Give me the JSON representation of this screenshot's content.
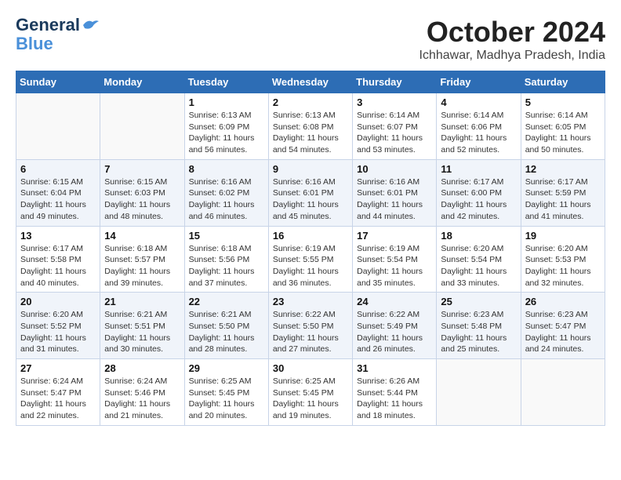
{
  "logo": {
    "line1": "General",
    "line2": "Blue"
  },
  "title": "October 2024",
  "location": "Ichhawar, Madhya Pradesh, India",
  "weekdays": [
    "Sunday",
    "Monday",
    "Tuesday",
    "Wednesday",
    "Thursday",
    "Friday",
    "Saturday"
  ],
  "weeks": [
    [
      {
        "day": null,
        "info": null
      },
      {
        "day": null,
        "info": null
      },
      {
        "day": "1",
        "sunrise": "6:13 AM",
        "sunset": "6:09 PM",
        "daylight": "11 hours and 56 minutes."
      },
      {
        "day": "2",
        "sunrise": "6:13 AM",
        "sunset": "6:08 PM",
        "daylight": "11 hours and 54 minutes."
      },
      {
        "day": "3",
        "sunrise": "6:14 AM",
        "sunset": "6:07 PM",
        "daylight": "11 hours and 53 minutes."
      },
      {
        "day": "4",
        "sunrise": "6:14 AM",
        "sunset": "6:06 PM",
        "daylight": "11 hours and 52 minutes."
      },
      {
        "day": "5",
        "sunrise": "6:14 AM",
        "sunset": "6:05 PM",
        "daylight": "11 hours and 50 minutes."
      }
    ],
    [
      {
        "day": "6",
        "sunrise": "6:15 AM",
        "sunset": "6:04 PM",
        "daylight": "11 hours and 49 minutes."
      },
      {
        "day": "7",
        "sunrise": "6:15 AM",
        "sunset": "6:03 PM",
        "daylight": "11 hours and 48 minutes."
      },
      {
        "day": "8",
        "sunrise": "6:16 AM",
        "sunset": "6:02 PM",
        "daylight": "11 hours and 46 minutes."
      },
      {
        "day": "9",
        "sunrise": "6:16 AM",
        "sunset": "6:01 PM",
        "daylight": "11 hours and 45 minutes."
      },
      {
        "day": "10",
        "sunrise": "6:16 AM",
        "sunset": "6:01 PM",
        "daylight": "11 hours and 44 minutes."
      },
      {
        "day": "11",
        "sunrise": "6:17 AM",
        "sunset": "6:00 PM",
        "daylight": "11 hours and 42 minutes."
      },
      {
        "day": "12",
        "sunrise": "6:17 AM",
        "sunset": "5:59 PM",
        "daylight": "11 hours and 41 minutes."
      }
    ],
    [
      {
        "day": "13",
        "sunrise": "6:17 AM",
        "sunset": "5:58 PM",
        "daylight": "11 hours and 40 minutes."
      },
      {
        "day": "14",
        "sunrise": "6:18 AM",
        "sunset": "5:57 PM",
        "daylight": "11 hours and 39 minutes."
      },
      {
        "day": "15",
        "sunrise": "6:18 AM",
        "sunset": "5:56 PM",
        "daylight": "11 hours and 37 minutes."
      },
      {
        "day": "16",
        "sunrise": "6:19 AM",
        "sunset": "5:55 PM",
        "daylight": "11 hours and 36 minutes."
      },
      {
        "day": "17",
        "sunrise": "6:19 AM",
        "sunset": "5:54 PM",
        "daylight": "11 hours and 35 minutes."
      },
      {
        "day": "18",
        "sunrise": "6:20 AM",
        "sunset": "5:54 PM",
        "daylight": "11 hours and 33 minutes."
      },
      {
        "day": "19",
        "sunrise": "6:20 AM",
        "sunset": "5:53 PM",
        "daylight": "11 hours and 32 minutes."
      }
    ],
    [
      {
        "day": "20",
        "sunrise": "6:20 AM",
        "sunset": "5:52 PM",
        "daylight": "11 hours and 31 minutes."
      },
      {
        "day": "21",
        "sunrise": "6:21 AM",
        "sunset": "5:51 PM",
        "daylight": "11 hours and 30 minutes."
      },
      {
        "day": "22",
        "sunrise": "6:21 AM",
        "sunset": "5:50 PM",
        "daylight": "11 hours and 28 minutes."
      },
      {
        "day": "23",
        "sunrise": "6:22 AM",
        "sunset": "5:50 PM",
        "daylight": "11 hours and 27 minutes."
      },
      {
        "day": "24",
        "sunrise": "6:22 AM",
        "sunset": "5:49 PM",
        "daylight": "11 hours and 26 minutes."
      },
      {
        "day": "25",
        "sunrise": "6:23 AM",
        "sunset": "5:48 PM",
        "daylight": "11 hours and 25 minutes."
      },
      {
        "day": "26",
        "sunrise": "6:23 AM",
        "sunset": "5:47 PM",
        "daylight": "11 hours and 24 minutes."
      }
    ],
    [
      {
        "day": "27",
        "sunrise": "6:24 AM",
        "sunset": "5:47 PM",
        "daylight": "11 hours and 22 minutes."
      },
      {
        "day": "28",
        "sunrise": "6:24 AM",
        "sunset": "5:46 PM",
        "daylight": "11 hours and 21 minutes."
      },
      {
        "day": "29",
        "sunrise": "6:25 AM",
        "sunset": "5:45 PM",
        "daylight": "11 hours and 20 minutes."
      },
      {
        "day": "30",
        "sunrise": "6:25 AM",
        "sunset": "5:45 PM",
        "daylight": "11 hours and 19 minutes."
      },
      {
        "day": "31",
        "sunrise": "6:26 AM",
        "sunset": "5:44 PM",
        "daylight": "11 hours and 18 minutes."
      },
      {
        "day": null,
        "info": null
      },
      {
        "day": null,
        "info": null
      }
    ]
  ]
}
